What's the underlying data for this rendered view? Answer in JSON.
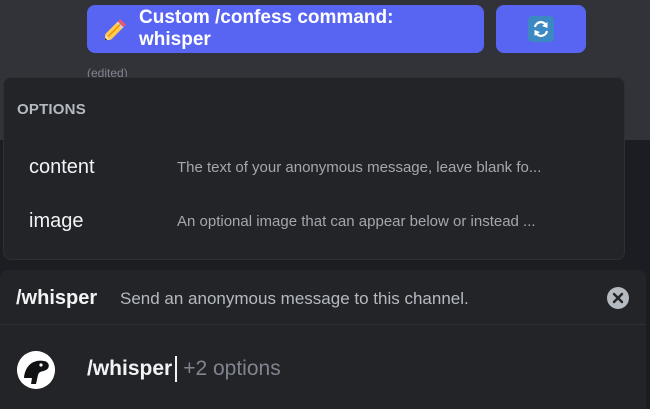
{
  "message": {
    "primary_button_label": "Custom /confess command: whisper",
    "primary_button_icon": "pencil-icon",
    "secondary_button_icon": "refresh-icon",
    "edited_label": "(edited)",
    "accent_color": "#5865f2"
  },
  "options_popup": {
    "header": "OPTIONS",
    "items": [
      {
        "name": "content",
        "description": "The text of your anonymous message, leave blank fo..."
      },
      {
        "name": "image",
        "description": "An optional image that can appear below or instead ..."
      }
    ]
  },
  "command": {
    "name": "/whisper",
    "description": "Send an anonymous message to this channel.",
    "close_icon": "close-icon"
  },
  "composer": {
    "avatar_icon": "bot-avatar-icon",
    "typed_command": "/whisper",
    "options_hint": "+2 options"
  }
}
